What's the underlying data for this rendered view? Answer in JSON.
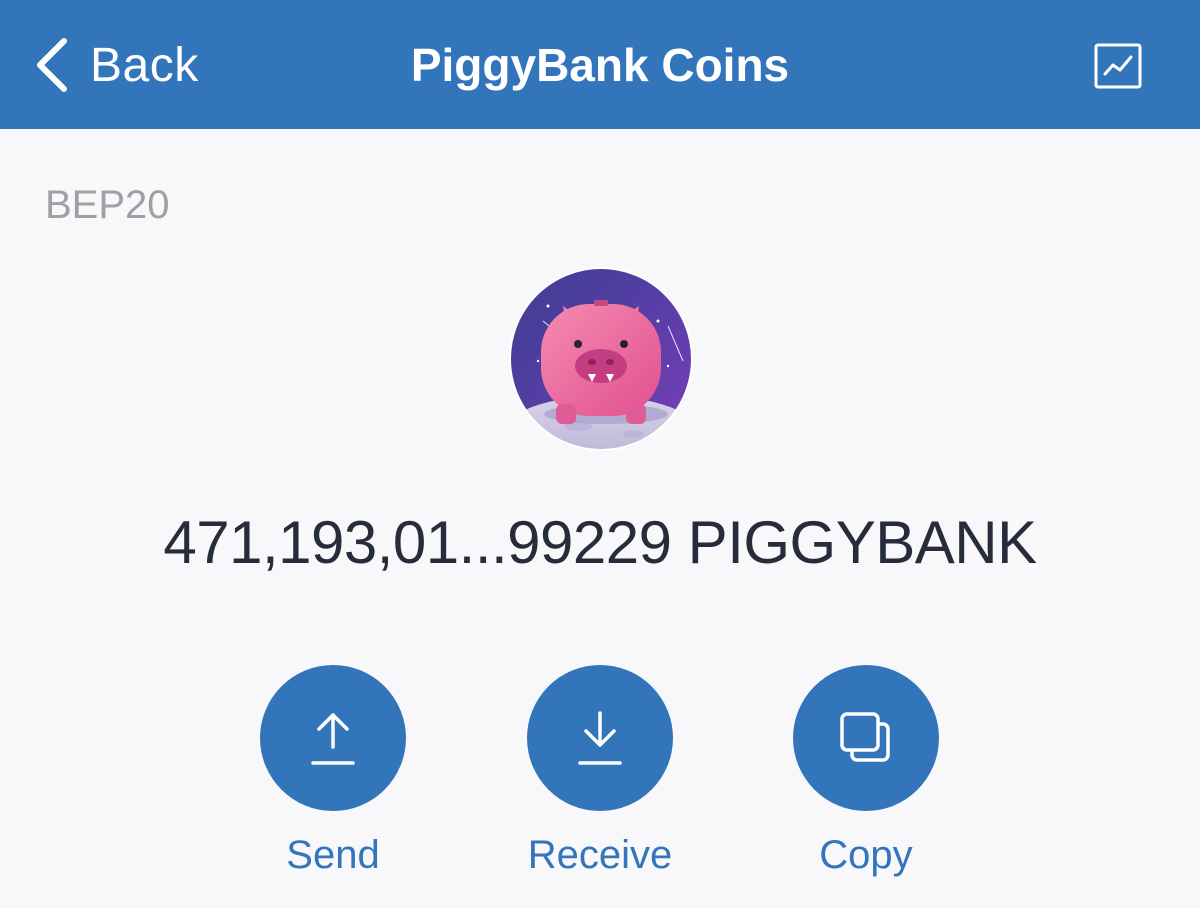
{
  "header": {
    "back_label": "Back",
    "title": "PiggyBank Coins",
    "chart_icon": "line-chart-icon"
  },
  "token": {
    "network": "BEP20",
    "logo_icon": "piggybank-logo",
    "balance": "471,193,01...99229 PIGGYBANK"
  },
  "actions": [
    {
      "label": "Send",
      "icon": "upload-arrow-icon"
    },
    {
      "label": "Receive",
      "icon": "download-arrow-icon"
    },
    {
      "label": "Copy",
      "icon": "copy-icon"
    }
  ],
  "colors": {
    "brand_blue": "#3375bb",
    "background": "#f8f8fa",
    "balance_text": "#262c3a",
    "muted_text": "#a0a0a4"
  }
}
